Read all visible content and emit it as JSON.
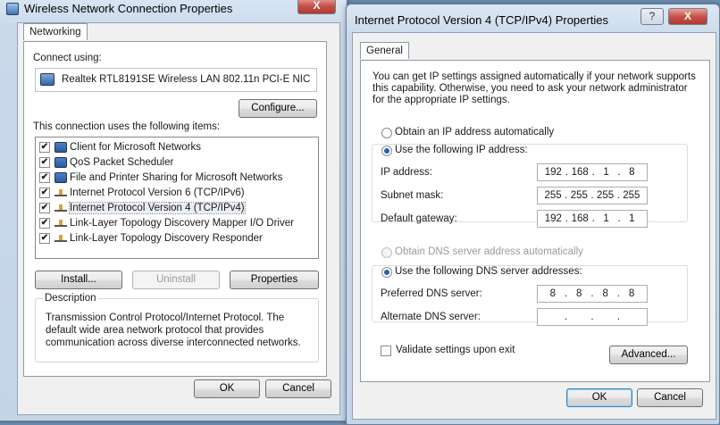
{
  "left_window": {
    "title": "Wireless Network Connection Properties",
    "tab": "Networking",
    "connect_using_label": "Connect using:",
    "adapter": "Realtek RTL8191SE Wireless LAN 802.11n PCI-E NIC",
    "configure_label": "Configure...",
    "items_label": "This connection uses the following items:",
    "items": [
      {
        "label": "Client for Microsoft Networks",
        "checked": true
      },
      {
        "label": "QoS Packet Scheduler",
        "checked": true
      },
      {
        "label": "File and Printer Sharing for Microsoft Networks",
        "checked": true
      },
      {
        "label": "Internet Protocol Version 6 (TCP/IPv6)",
        "checked": true
      },
      {
        "label": "Internet Protocol Version 4 (TCP/IPv4)",
        "checked": true
      },
      {
        "label": "Link-Layer Topology Discovery Mapper I/O Driver",
        "checked": true
      },
      {
        "label": "Link-Layer Topology Discovery Responder",
        "checked": true
      }
    ],
    "install_label": "Install...",
    "uninstall_label": "Uninstall",
    "properties_label": "Properties",
    "description_legend": "Description",
    "description_text": "Transmission Control Protocol/Internet Protocol. The default wide area network protocol that provides communication across diverse interconnected networks.",
    "ok_label": "OK",
    "cancel_label": "Cancel",
    "close_glyph": "X"
  },
  "right_window": {
    "title": "Internet Protocol Version 4 (TCP/IPv4) Properties",
    "help_glyph": "?",
    "close_glyph": "X",
    "tab": "General",
    "intro": "You can get IP settings assigned automatically if your network supports this capability. Otherwise, you need to ask your network administrator for the appropriate IP settings.",
    "obtain_ip_auto": "Obtain an IP address automatically",
    "use_following_ip": "Use the following IP address:",
    "ip_address_label": "IP address:",
    "ip_address": [
      "192",
      "168",
      "1",
      "8"
    ],
    "subnet_label": "Subnet mask:",
    "subnet": [
      "255",
      "255",
      "255",
      "255"
    ],
    "gateway_label": "Default gateway:",
    "gateway": [
      "192",
      "168",
      "1",
      "1"
    ],
    "obtain_dns_auto": "Obtain DNS server address automatically",
    "use_following_dns": "Use the following DNS server addresses:",
    "preferred_dns_label": "Preferred DNS server:",
    "preferred_dns": [
      "8",
      "8",
      "8",
      "8"
    ],
    "alternate_dns_label": "Alternate DNS server:",
    "alternate_dns": [
      "",
      "",
      "",
      ""
    ],
    "validate_label": "Validate settings upon exit",
    "validate_checked": false,
    "advanced_label": "Advanced...",
    "ok_label": "OK",
    "cancel_label": "Cancel"
  }
}
